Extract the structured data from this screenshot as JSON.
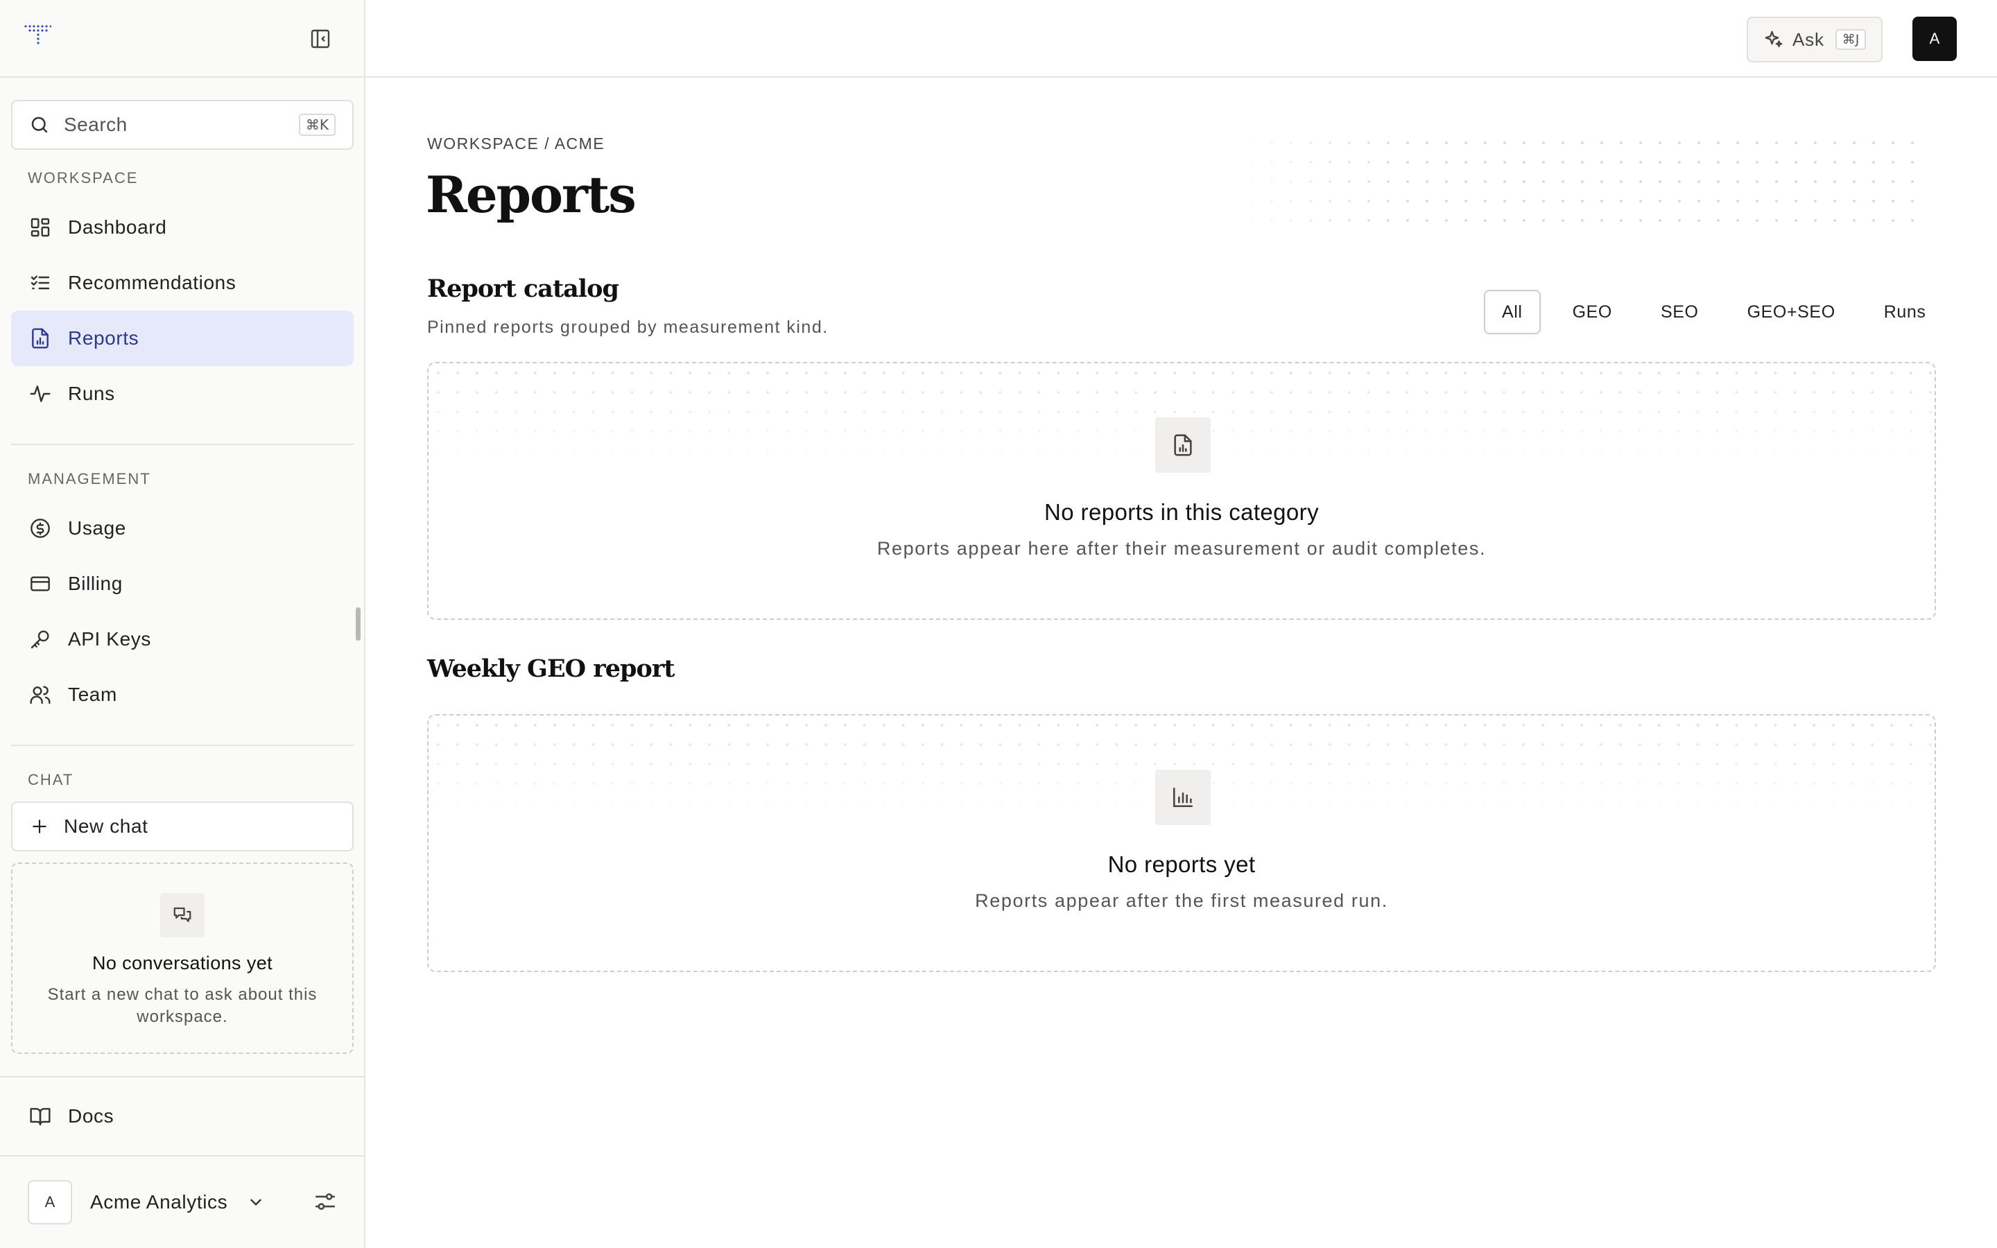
{
  "sidebar": {
    "search": {
      "placeholder": "Search",
      "shortcut": "⌘K"
    },
    "sections": {
      "workspace": "WORKSPACE",
      "management": "MANAGEMENT",
      "chat": "CHAT"
    },
    "workspace_items": [
      {
        "label": "Dashboard",
        "icon": "grid-icon"
      },
      {
        "label": "Recommendations",
        "icon": "list-checks-icon"
      },
      {
        "label": "Reports",
        "icon": "file-chart-icon",
        "active": true
      },
      {
        "label": "Runs",
        "icon": "activity-icon"
      }
    ],
    "management_items": [
      {
        "label": "Usage",
        "icon": "dollar-circle-icon"
      },
      {
        "label": "Billing",
        "icon": "credit-card-icon"
      },
      {
        "label": "API Keys",
        "icon": "key-icon"
      },
      {
        "label": "Team",
        "icon": "users-icon"
      }
    ],
    "chat": {
      "new_chat": "New chat",
      "empty_title": "No conversations yet",
      "empty_desc": "Start a new chat to ask about this workspace."
    },
    "docs": "Docs",
    "org": {
      "avatar": "A",
      "name": "Acme Analytics"
    }
  },
  "topbar": {
    "ask_label": "Ask",
    "ask_shortcut": "⌘J",
    "user_avatar": "A"
  },
  "main": {
    "breadcrumb": "WORKSPACE / ACME",
    "title": "Reports",
    "catalog": {
      "title": "Report catalog",
      "subtitle": "Pinned reports grouped by measurement kind.",
      "filters": [
        "All",
        "GEO",
        "SEO",
        "GEO+SEO",
        "Runs"
      ],
      "active_filter": "All",
      "empty_title": "No reports in this category",
      "empty_desc": "Reports appear here after their measurement or audit completes."
    },
    "weekly": {
      "title": "Weekly GEO report",
      "empty_title": "No reports yet",
      "empty_desc": "Reports appear after the first measured run."
    }
  },
  "colors": {
    "active_nav_bg": "#e6e9fa",
    "active_nav_text": "#2d3a8c",
    "logo": "#3b4bb0"
  }
}
